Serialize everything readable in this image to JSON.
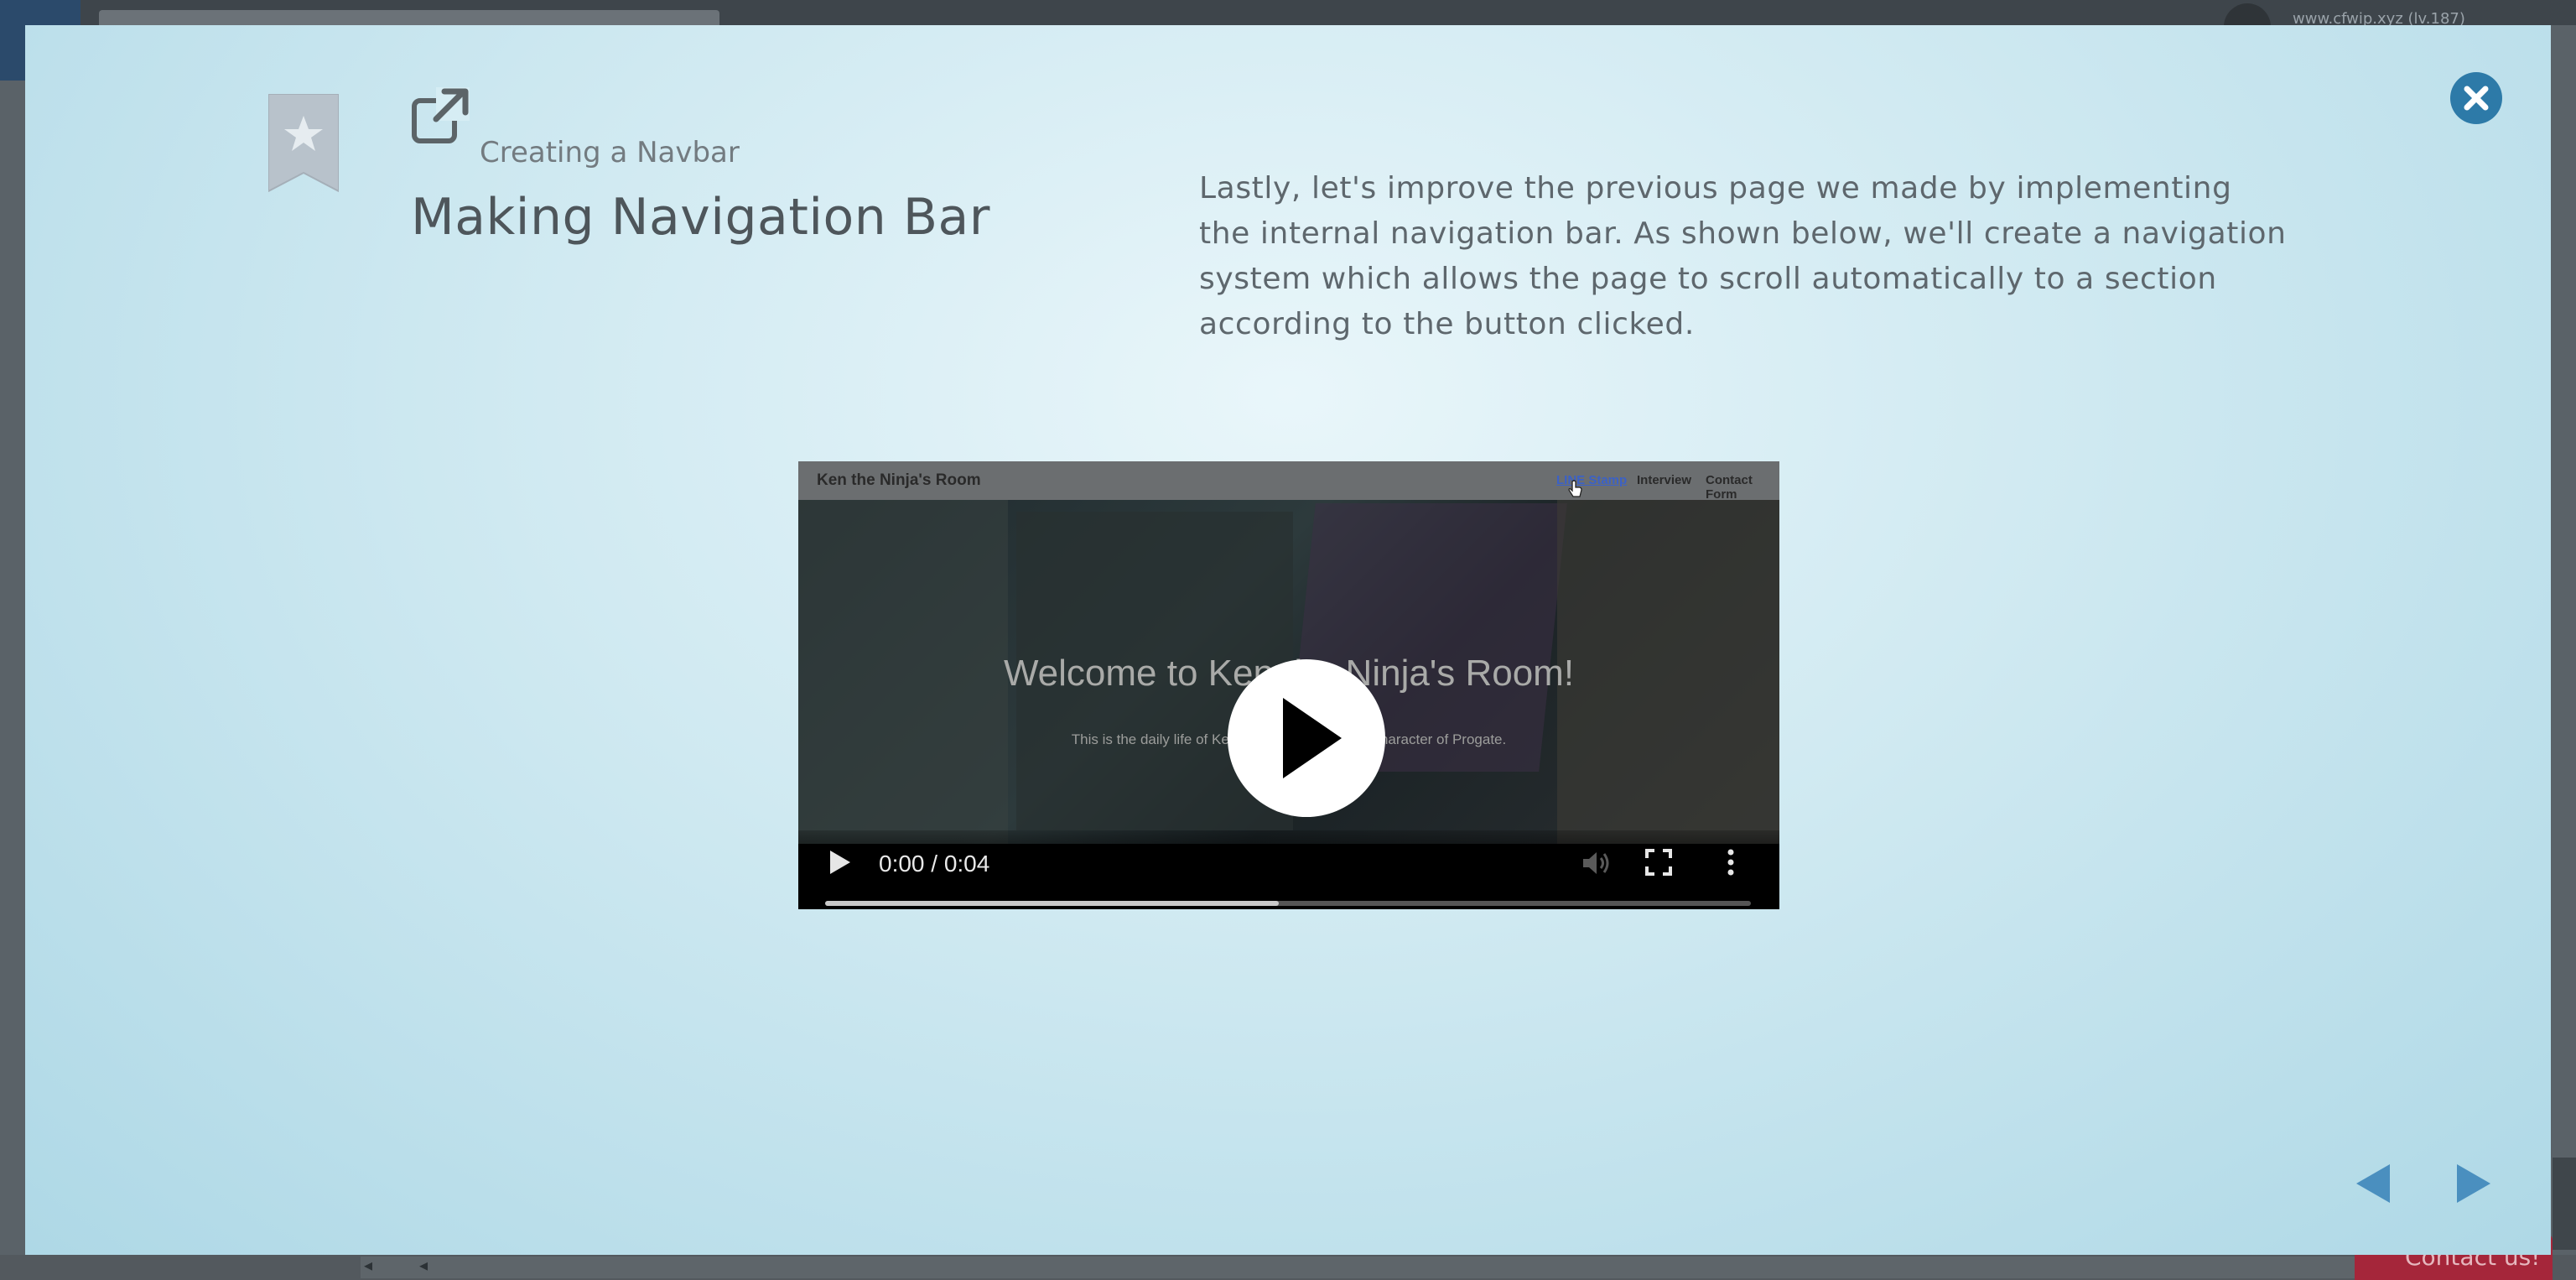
{
  "background": {
    "user_label": "www.cfwip.xyz (lv.187)",
    "contact_label": "Contact us!"
  },
  "modal": {
    "subtitle": "Creating a Navbar",
    "title": "Making Navigation Bar",
    "description": "Lastly, let's improve the previous page we made by implementing the internal navigation bar. As shown below, we'll create a navigation system which allows the page to scroll automatically to a section according to the button clicked.",
    "icons": {
      "bookmark": "star-bookmark-icon",
      "external": "external-link-icon",
      "close": "close-icon",
      "prev": "prev-arrow-icon",
      "next": "next-arrow-icon"
    },
    "colors": {
      "close_bg": "#2d7aa8",
      "arrows": "#4a8fbf",
      "bookmark": "#b8c2cb"
    }
  },
  "video": {
    "site_title": "Ken the Ninja's Room",
    "nav": [
      "LINE Stamp",
      "Interview",
      "Contact Form"
    ],
    "active_nav": "LINE Stamp",
    "welcome_text": "Welcome to Ken the Ninja's Room!",
    "sub_text": "This is the daily life of Ken the Ninja, the official character of Progate.",
    "time": "0:00 / 0:04",
    "progress_fraction": 0.49
  }
}
